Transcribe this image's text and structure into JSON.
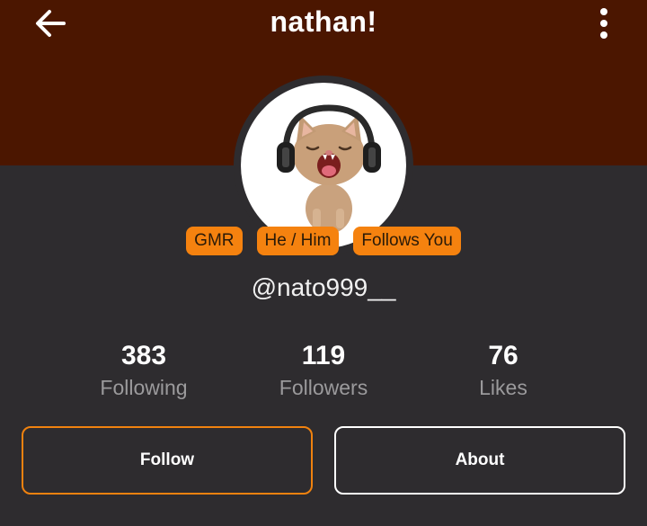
{
  "header": {
    "title": "nathan!",
    "back_icon": "arrow-left-icon",
    "more_icon": "more-vertical-icon",
    "background": "#4b1600"
  },
  "profile": {
    "avatar": "cat-with-headphones",
    "badges": [
      "GMR",
      "He / Him",
      "Follows You"
    ],
    "badge_color": "#f5820f",
    "handle": "@nato999__"
  },
  "stats": [
    {
      "value": "383",
      "label": "Following"
    },
    {
      "value": "119",
      "label": "Followers"
    },
    {
      "value": "76",
      "label": "Likes"
    }
  ],
  "actions": {
    "follow_label": "Follow",
    "about_label": "About",
    "follow_border": "#f0820f"
  }
}
